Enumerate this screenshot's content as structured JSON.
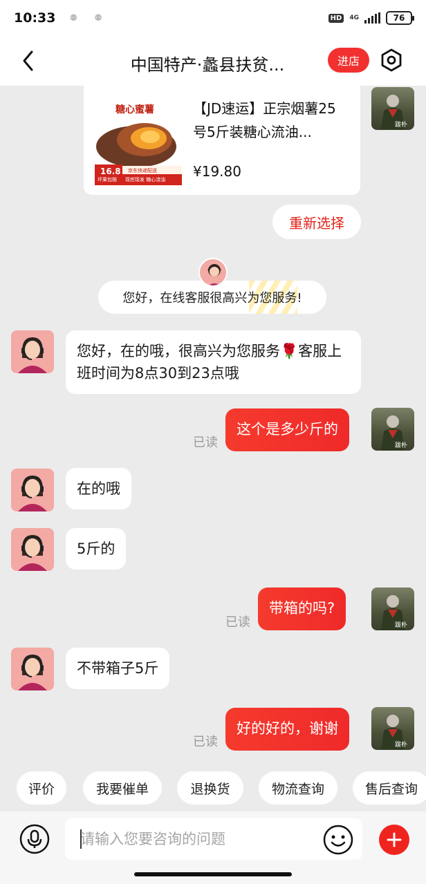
{
  "status_bar": {
    "time": "10:33",
    "notif_icons": "⚉ ⚉",
    "hd": "HD",
    "network": "4G",
    "battery": "76"
  },
  "header": {
    "title": "中国特产·蠡县扶贫...",
    "shop_button": "进店",
    "back_icon": "chevron-left-icon",
    "settings_icon": "hexagon-settings-icon"
  },
  "product_card": {
    "image_banner": "糖心蜜薯",
    "image_price_tag": "16.8",
    "image_tag_left": "坏果包赔",
    "image_tag_right": "现挖现发 糖心流油",
    "image_tag_top": "京东快递配送",
    "title": "【JD速运】正宗烟薯25号5斤装糖心流油...",
    "price": "¥19.80",
    "reselect_button": "重新选择"
  },
  "system_message": "您好，在线客服很高兴为您服务!",
  "user_avatar_caption": "跋朴",
  "messages": [
    {
      "side": "left",
      "text": "您好，在的哦，很高兴为您服务🌹客服上班时间为8点30到23点哦"
    },
    {
      "side": "right",
      "text": "这个是多少斤的",
      "status": "已读"
    },
    {
      "side": "left",
      "text": "在的哦"
    },
    {
      "side": "left",
      "text": "5斤的"
    },
    {
      "side": "right",
      "text": "带箱的吗?",
      "status": "已读"
    },
    {
      "side": "left",
      "text": "不带箱子5斤"
    },
    {
      "side": "right",
      "text": "好的好的，谢谢",
      "status": "已读"
    }
  ],
  "quick_actions": [
    "评价",
    "我要催单",
    "退换货",
    "物流查询",
    "售后查询"
  ],
  "input_bar": {
    "placeholder": "请输入您要咨询的问题",
    "mic_icon": "microphone-icon",
    "emoji_icon": "smiley-icon",
    "plus_icon": "plus-icon"
  },
  "colors": {
    "accent": "#f23030",
    "bubble_self": "#f53a2d",
    "background": "#ebebeb"
  }
}
